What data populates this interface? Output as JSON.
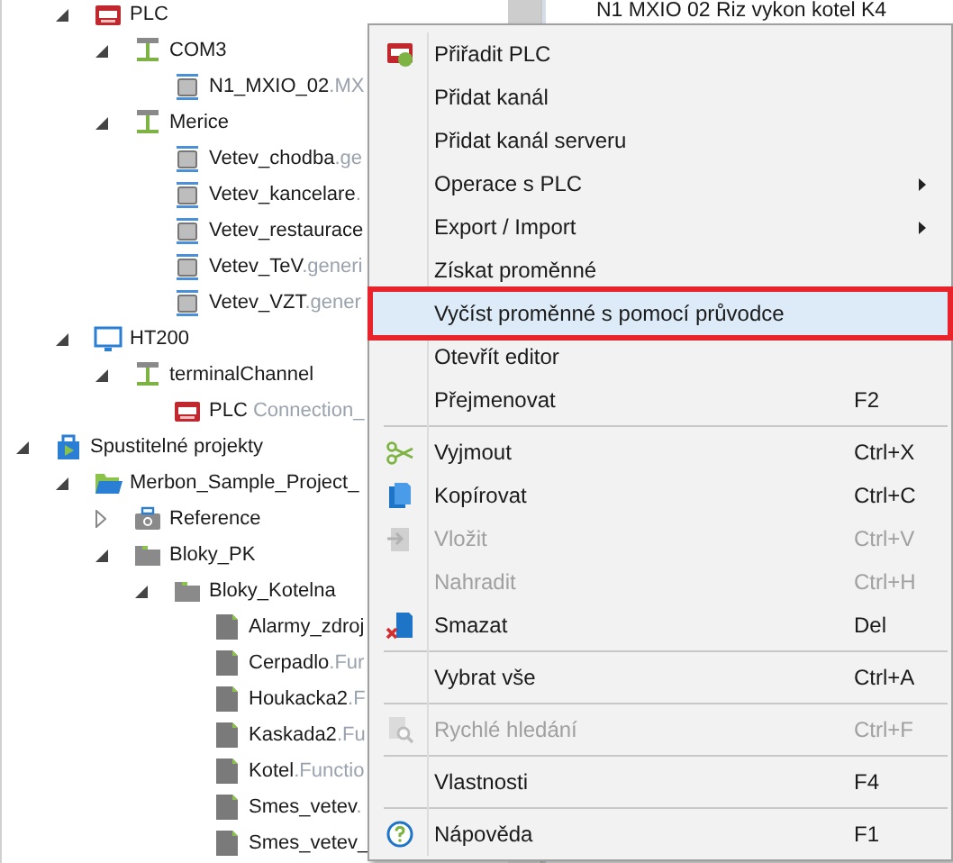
{
  "tree": [
    {
      "name": "PLC",
      "kind": "plc",
      "expanded": true,
      "children": [
        {
          "name": "COM3",
          "kind": "channel",
          "expanded": true,
          "children": [
            {
              "name": "N1_MXIO_02",
              "suffix": ".MX",
              "kind": "device"
            }
          ]
        },
        {
          "name": "Merice",
          "kind": "channel",
          "expanded": true,
          "children": [
            {
              "name": "Vetev_chodba",
              "suffix": ".ge",
              "kind": "device"
            },
            {
              "name": "Vetev_kancelare",
              "suffix": ".",
              "kind": "device"
            },
            {
              "name": "Vetev_restaurace",
              "kind": "device"
            },
            {
              "name": "Vetev_TeV",
              "suffix": ".generi",
              "kind": "device"
            },
            {
              "name": "Vetev_VZT",
              "suffix": ".gener",
              "kind": "device"
            }
          ]
        }
      ]
    },
    {
      "name": "HT200",
      "kind": "terminal",
      "expanded": true,
      "children": [
        {
          "name": "terminalChannel",
          "kind": "channel",
          "expanded": true,
          "children": [
            {
              "name": "PLC",
              "suffix": " Connection_",
              "kind": "plc"
            }
          ]
        }
      ]
    },
    {
      "name": "Spustitelné projekty",
      "kind": "project",
      "expanded": true,
      "children": [
        {
          "name": "Merbon_Sample_Project_",
          "kind": "project-folder",
          "expanded": true,
          "children": [
            {
              "name": "Reference",
              "kind": "reference",
              "expanded": false
            },
            {
              "name": "Bloky_PK",
              "kind": "folder",
              "expanded": true,
              "children": [
                {
                  "name": "Bloky_Kotelna",
                  "kind": "folder",
                  "expanded": true,
                  "children": [
                    {
                      "name": "Alarmy_zdroj",
                      "kind": "file"
                    },
                    {
                      "name": "Cerpadlo",
                      "suffix": ".Fur",
                      "kind": "file"
                    },
                    {
                      "name": "Houkacka2",
                      "suffix": ".F",
                      "kind": "file"
                    },
                    {
                      "name": "Kaskada2",
                      "suffix": ".Fu",
                      "kind": "file"
                    },
                    {
                      "name": "Kotel",
                      "suffix": ".Functio",
                      "kind": "file"
                    },
                    {
                      "name": "Smes_vetev",
                      "suffix": ".",
                      "kind": "file"
                    },
                    {
                      "name": "Smes_vetev_",
                      "kind": "file"
                    }
                  ]
                }
              ]
            }
          ]
        }
      ]
    }
  ],
  "right_panel": {
    "text": "N1 MXIO 02 Riz vykon kotel K4"
  },
  "context_menu": [
    {
      "kind": "item",
      "label": "Přiřadit PLC",
      "disabled": false,
      "submenu": false,
      "selected": false
    },
    {
      "kind": "item",
      "label": "Přidat kanál",
      "disabled": false,
      "submenu": false,
      "selected": false
    },
    {
      "kind": "item",
      "label": "Přidat kanál serveru",
      "disabled": false,
      "submenu": false,
      "selected": false
    },
    {
      "kind": "item",
      "label": "Operace s PLC",
      "disabled": false,
      "submenu": true,
      "selected": false
    },
    {
      "kind": "item",
      "label": "Export / Import",
      "disabled": false,
      "submenu": true,
      "selected": false
    },
    {
      "kind": "item",
      "label": "Získat proměnné",
      "disabled": false,
      "submenu": false,
      "selected": false
    },
    {
      "kind": "item",
      "label": "Vyčíst proměnné s pomocí průvodce",
      "disabled": false,
      "submenu": false,
      "selected": true
    },
    {
      "kind": "item",
      "label": "Otevřít editor",
      "disabled": false,
      "submenu": false,
      "selected": false
    },
    {
      "kind": "item",
      "label": "Přejmenovat",
      "shortcut": "F2",
      "disabled": false,
      "submenu": false,
      "selected": false
    },
    {
      "kind": "separator"
    },
    {
      "kind": "item",
      "label": "Vyjmout",
      "shortcut": "Ctrl+X",
      "disabled": false,
      "submenu": false,
      "selected": false
    },
    {
      "kind": "item",
      "label": "Kopírovat",
      "shortcut": "Ctrl+C",
      "disabled": false,
      "submenu": false,
      "selected": false
    },
    {
      "kind": "item",
      "label": "Vložit",
      "shortcut": "Ctrl+V",
      "disabled": true,
      "submenu": false,
      "selected": false
    },
    {
      "kind": "item",
      "label": "Nahradit",
      "shortcut": "Ctrl+H",
      "disabled": true,
      "submenu": false,
      "selected": false
    },
    {
      "kind": "item",
      "label": "Smazat",
      "shortcut": "Del",
      "disabled": false,
      "submenu": false,
      "selected": false
    },
    {
      "kind": "separator"
    },
    {
      "kind": "item",
      "label": "Vybrat vše",
      "shortcut": "Ctrl+A",
      "disabled": false,
      "submenu": false,
      "selected": false
    },
    {
      "kind": "separator"
    },
    {
      "kind": "item",
      "label": "Rychlé hledání",
      "shortcut": "Ctrl+F",
      "disabled": true,
      "submenu": false,
      "selected": false
    },
    {
      "kind": "separator"
    },
    {
      "kind": "item",
      "label": "Vlastnosti",
      "shortcut": "F4",
      "disabled": false,
      "submenu": false,
      "selected": false
    },
    {
      "kind": "separator"
    },
    {
      "kind": "item",
      "label": "Nápověda",
      "shortcut": "F1",
      "disabled": false,
      "submenu": false,
      "selected": false
    }
  ]
}
